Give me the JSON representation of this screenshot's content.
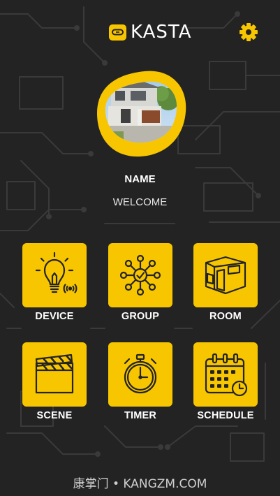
{
  "header": {
    "brand": "KASTA",
    "logo_icon": "infinity-link-icon",
    "settings_icon": "gear-icon"
  },
  "profile": {
    "name": "NAME",
    "subtitle": "WELCOME"
  },
  "tiles": [
    {
      "label": "DEVICE",
      "icon": "bulb-icon"
    },
    {
      "label": "GROUP",
      "icon": "group-network-icon"
    },
    {
      "label": "ROOM",
      "icon": "room-icon"
    },
    {
      "label": "SCENE",
      "icon": "clapperboard-icon"
    },
    {
      "label": "TIMER",
      "icon": "stopwatch-icon"
    },
    {
      "label": "SCHEDULE",
      "icon": "calendar-clock-icon"
    }
  ],
  "watermark": "康掌门 • KANGZM.COM",
  "colors": {
    "background": "#232323",
    "accent": "#f7c600",
    "text": "#ffffff"
  }
}
